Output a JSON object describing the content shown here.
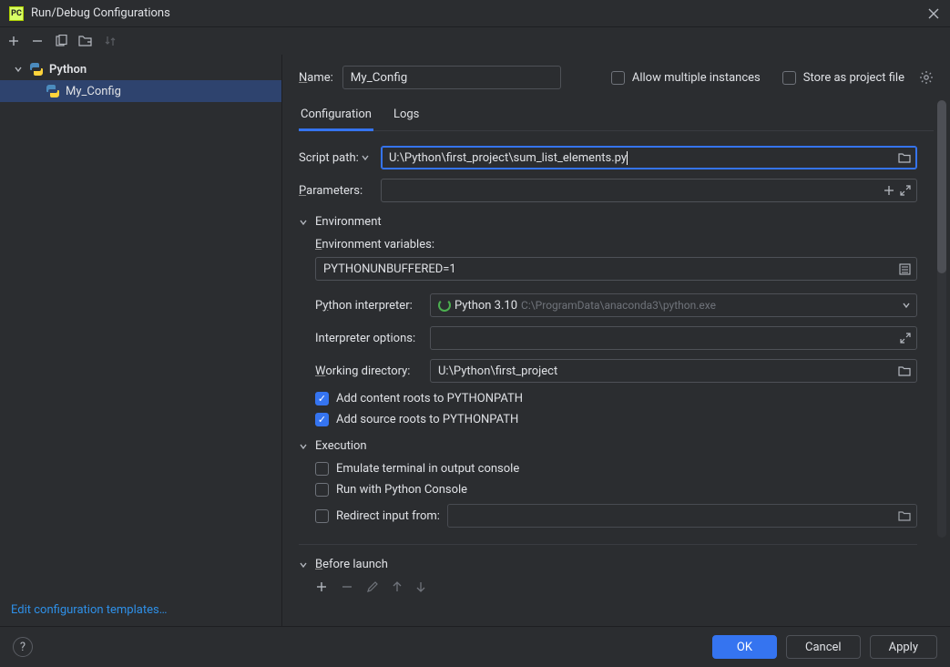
{
  "title": "Run/Debug Configurations",
  "tree": {
    "category": "Python",
    "item": "My_Config"
  },
  "editTemplates": "Edit configuration templates…",
  "nameLabel": "Name:",
  "nameValue": "My_Config",
  "allowMultiple": "Allow multiple instances",
  "storeAsFile": "Store as project file",
  "tabs": {
    "config": "Configuration",
    "logs": "Logs"
  },
  "form": {
    "scriptPathLabel": "Script path:",
    "scriptPathValue": "U:\\Python\\first_project\\sum_list_elements.py",
    "parametersLabel": "Parameters:",
    "envHeader": "Environment",
    "envVarsLabel": "Environment variables:",
    "envVarsValue": "PYTHONUNBUFFERED=1",
    "interpLabel": "Python interpreter:",
    "interpName": "Python 3.10",
    "interpPath": "C:\\ProgramData\\anaconda3\\python.exe",
    "interpOptLabel": "Interpreter options:",
    "workDirLabel": "Working directory:",
    "workDirValue": "U:\\Python\\first_project",
    "addContentRoots": "Add content roots to PYTHONPATH",
    "addSourceRoots": "Add source roots to PYTHONPATH",
    "execHeader": "Execution",
    "emulateTerminal": "Emulate terminal in output console",
    "runPyConsole": "Run with Python Console",
    "redirectInput": "Redirect input from:",
    "beforeLaunch": "Before launch"
  },
  "buttons": {
    "ok": "OK",
    "cancel": "Cancel",
    "apply": "Apply"
  }
}
